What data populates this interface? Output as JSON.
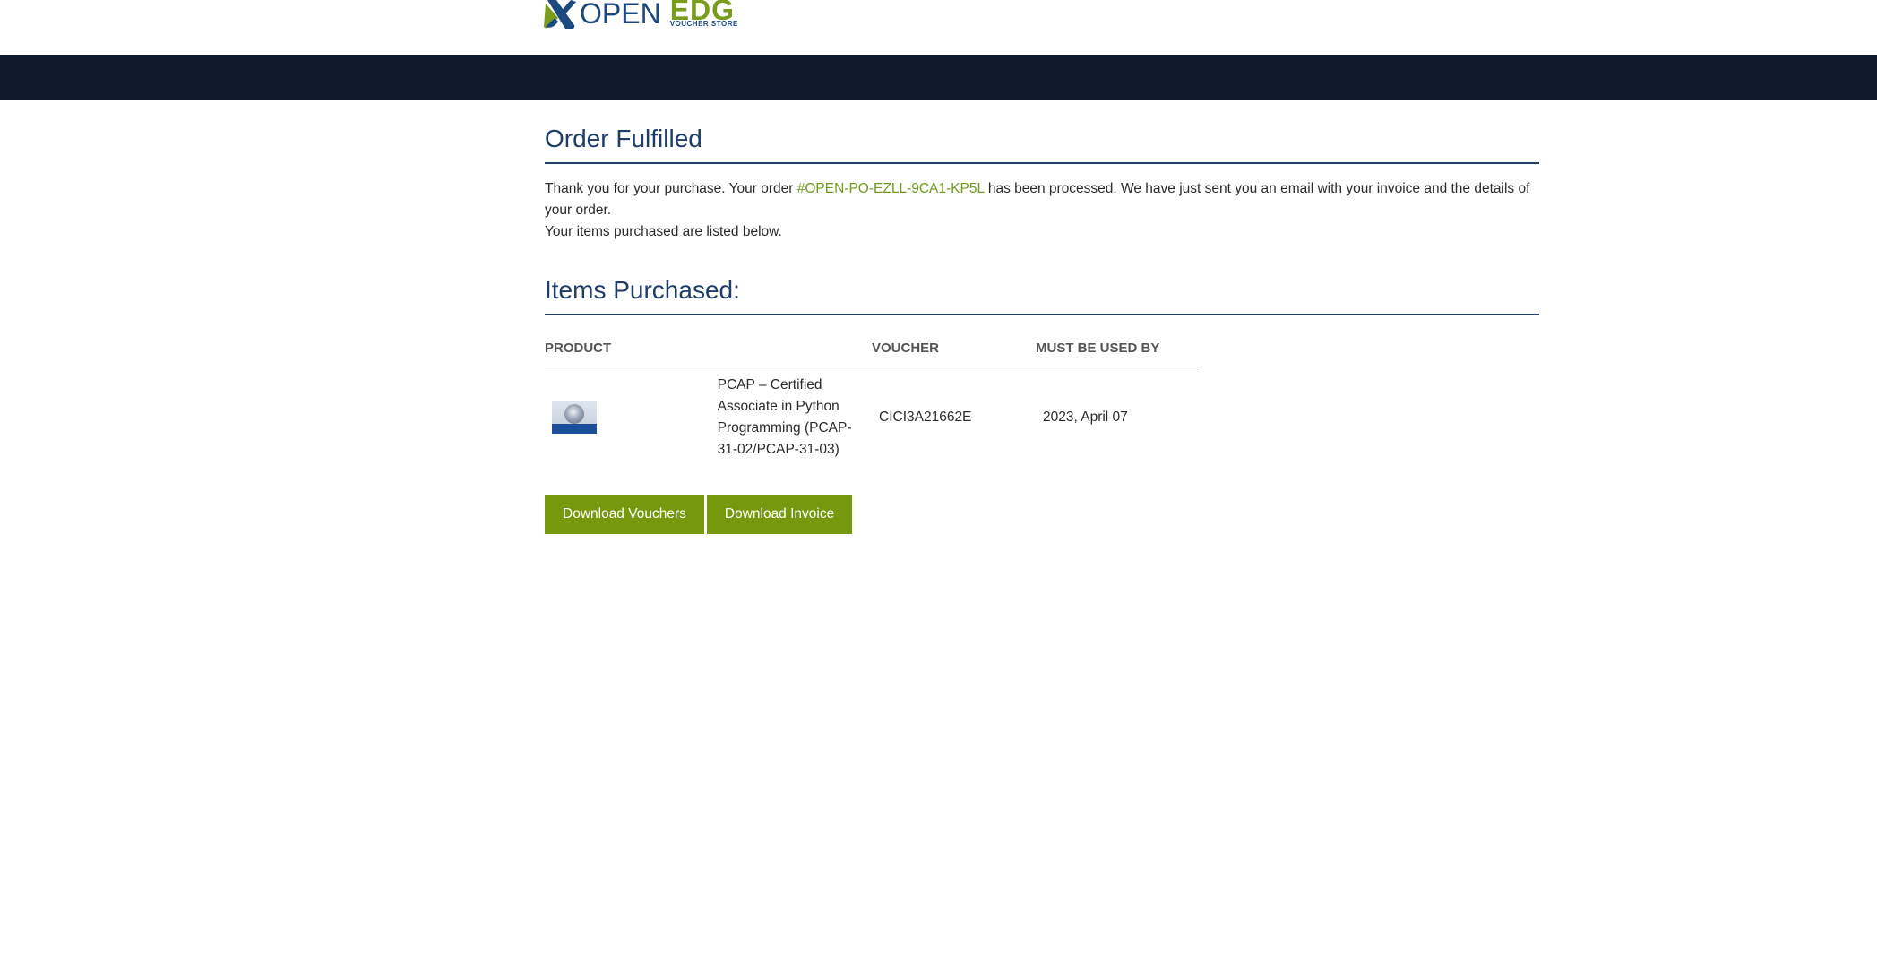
{
  "header": {
    "logo_open": "OPEN",
    "logo_edg": "EDG",
    "logo_sub": "VOUCHER STORE",
    "logo_icon": "x-logo-icon"
  },
  "main": {
    "title": "Order Fulfilled",
    "intro_prefix": "Thank you for your purchase. Your order ",
    "order_number": "#OPEN-PO-EZLL-9CA1-KP5L",
    "intro_suffix": " has been processed. We have just sent you an email with your invoice and the details of your order.",
    "intro_line2": "Your items purchased are listed below.",
    "items_title": "Items Purchased:"
  },
  "table": {
    "columns": [
      "PRODUCT",
      "VOUCHER",
      "MUST BE USED BY"
    ],
    "rows": [
      {
        "product_image": "pcap-badge-image",
        "product_name": "PCAP – Certified Associate in Python Programming (PCAP-31-02/PCAP-31-03)",
        "voucher": "CICI3A21662E",
        "must_be_used_by": "2023, April 07"
      }
    ]
  },
  "buttons": {
    "download_vouchers": "Download Vouchers",
    "download_invoice": "Download Invoice"
  },
  "colors": {
    "navbar": "#0e1a2b",
    "heading": "#1f3d66",
    "accent_green": "#76980e",
    "link_green": "#6f9a1c"
  }
}
